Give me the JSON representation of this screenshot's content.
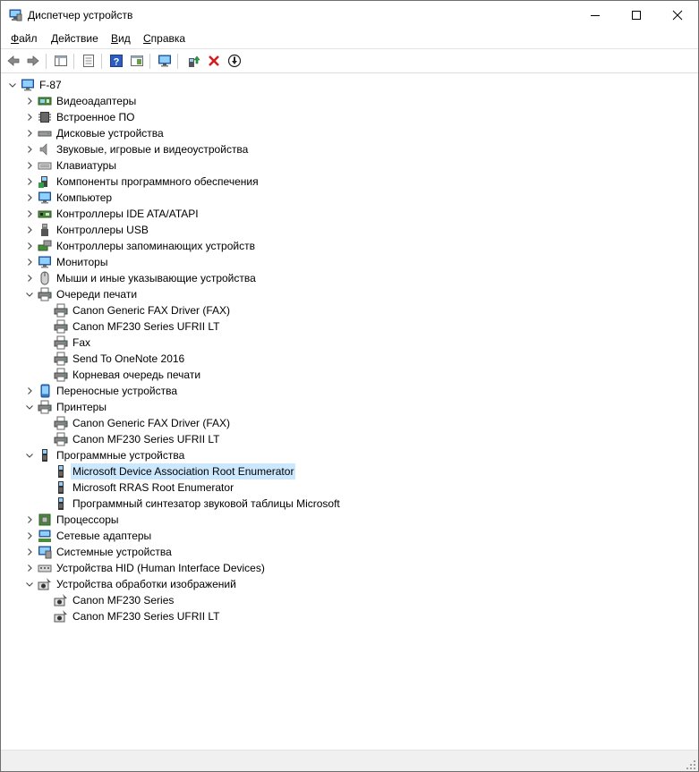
{
  "window": {
    "title": "Диспетчер устройств"
  },
  "menu": {
    "file": "Файл",
    "action": "Действие",
    "view": "Вид",
    "help": "Справка"
  },
  "tree": {
    "root": "F-87",
    "categories": [
      {
        "label": "Видеоадаптеры",
        "icon": "display-adapter-icon"
      },
      {
        "label": "Встроенное ПО",
        "icon": "firmware-icon"
      },
      {
        "label": "Дисковые устройства",
        "icon": "disk-drive-icon"
      },
      {
        "label": "Звуковые, игровые и видеоустройства",
        "icon": "speaker-icon"
      },
      {
        "label": "Клавиатуры",
        "icon": "keyboard-icon"
      },
      {
        "label": "Компоненты программного обеспечения",
        "icon": "software-component-icon"
      },
      {
        "label": "Компьютер",
        "icon": "computer-icon"
      },
      {
        "label": "Контроллеры IDE ATA/ATAPI",
        "icon": "ide-controller-icon"
      },
      {
        "label": "Контроллеры USB",
        "icon": "usb-icon"
      },
      {
        "label": "Контроллеры запоминающих устройств",
        "icon": "storage-controller-icon"
      },
      {
        "label": "Мониторы",
        "icon": "monitor-icon"
      },
      {
        "label": "Мыши и иные указывающие устройства",
        "icon": "mouse-icon"
      },
      {
        "label": "Очереди печати",
        "icon": "printer-icon",
        "children": [
          "Canon Generic FAX Driver (FAX)",
          "Canon MF230 Series UFRII LT",
          "Fax",
          "Send To OneNote 2016",
          "Корневая очередь печати"
        ]
      },
      {
        "label": "Переносные устройства",
        "icon": "portable-device-icon"
      },
      {
        "label": "Принтеры",
        "icon": "printer-icon",
        "children": [
          "Canon Generic FAX Driver (FAX)",
          "Canon MF230 Series UFRII LT"
        ]
      },
      {
        "label": "Программные устройства",
        "icon": "software-device-icon",
        "children": [
          "Microsoft Device Association Root Enumerator",
          "Microsoft RRAS Root Enumerator",
          "Программный синтезатор звуковой таблицы Microsoft"
        ]
      },
      {
        "label": "Процессоры",
        "icon": "processor-icon"
      },
      {
        "label": "Сетевые адаптеры",
        "icon": "network-adapter-icon"
      },
      {
        "label": "Системные устройства",
        "icon": "system-device-icon"
      },
      {
        "label": "Устройства HID (Human Interface Devices)",
        "icon": "hid-icon"
      },
      {
        "label": "Устройства обработки изображений",
        "icon": "imaging-device-icon",
        "children": [
          "Canon MF230 Series",
          "Canon MF230 Series UFRII LT"
        ]
      }
    ],
    "selected": "Microsoft Device Association Root Enumerator"
  }
}
